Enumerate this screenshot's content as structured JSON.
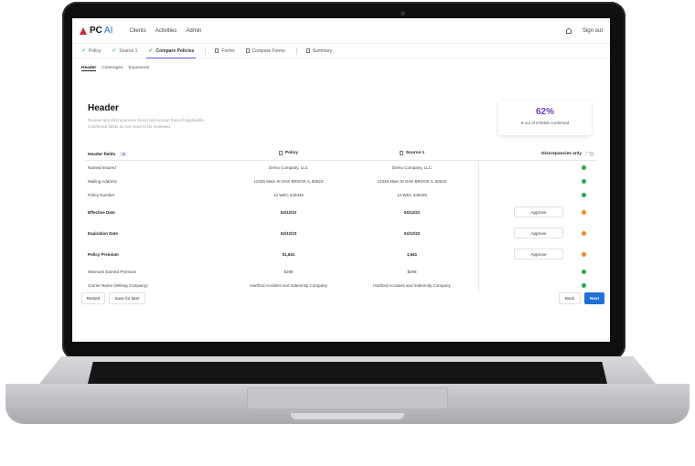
{
  "nav": {
    "logo_main": "PC",
    "logo_ai": "AI",
    "links": [
      "Clients",
      "Activities",
      "Admin"
    ],
    "sign_out": "Sign out"
  },
  "steps": [
    {
      "label": "Policy",
      "state": "done"
    },
    {
      "label": "Source 1",
      "state": "done"
    },
    {
      "label": "Compare Policies",
      "state": "active"
    },
    {
      "label": "Forms",
      "state": "todo"
    },
    {
      "label": "Compare Forms",
      "state": "todo"
    },
    {
      "label": "Summary",
      "state": "todo"
    }
  ],
  "subtabs": [
    "Header",
    "Coverages",
    "Exposures"
  ],
  "page": {
    "title": "Header",
    "desc_line1": "Review any discrepancies found and accept them if applicable.",
    "desc_line2": "Confirmed fields do not need to be reviewed."
  },
  "score": {
    "percent": "62%",
    "text": "5 out of 8 fields confirmed"
  },
  "table": {
    "header_fields": "Header fields",
    "count": "8",
    "col_policy": "Policy",
    "col_source": "Source 1",
    "discrepancies_only": "Discrepancies only",
    "approve_label": "Approve",
    "rows": [
      {
        "field": "Named Insured",
        "policy": "Demo Company, LLC",
        "source": "Demo Company, LLC",
        "status": "ok",
        "bold": false
      },
      {
        "field": "Mailing Address",
        "policy": "12345 Main St OAK BROOK IL 60523",
        "source": "12345 Main St OAK BROOK IL 60523",
        "status": "ok",
        "bold": false
      },
      {
        "field": "Policy Number",
        "policy": "12 WEC 845345",
        "source": "12 WEC 845345",
        "status": "ok",
        "bold": false
      },
      {
        "field": "Effective Date",
        "policy": "04/12/22",
        "source": "04/12/21",
        "status": "warn",
        "bold": true
      },
      {
        "field": "Expiration Date",
        "policy": "04/12/23",
        "source": "04/12/22",
        "status": "warn",
        "bold": true
      },
      {
        "field": "Policy Premium",
        "policy": "$1,641",
        "source": "1,641",
        "status": "warn",
        "bold": true
      },
      {
        "field": "Minimum Earned Premium",
        "policy": "$298",
        "source": "$298",
        "status": "ok",
        "bold": false
      },
      {
        "field": "Carrier Name (Writing Company)",
        "policy": "Hartford Accident and Indemnity Company",
        "source": "Hartford Accident and Indemnity Company",
        "status": "ok",
        "bold": false
      }
    ]
  },
  "footer": {
    "restart": "Restart",
    "save_later": "Save for later",
    "back": "Back",
    "next": "Next"
  },
  "colors": {
    "accent_purple": "#6a3fb8",
    "primary_blue": "#1f6fd6",
    "ok_green": "#2fa44f",
    "warn_orange": "#ef8a2b",
    "logo_red": "#d0243a"
  }
}
